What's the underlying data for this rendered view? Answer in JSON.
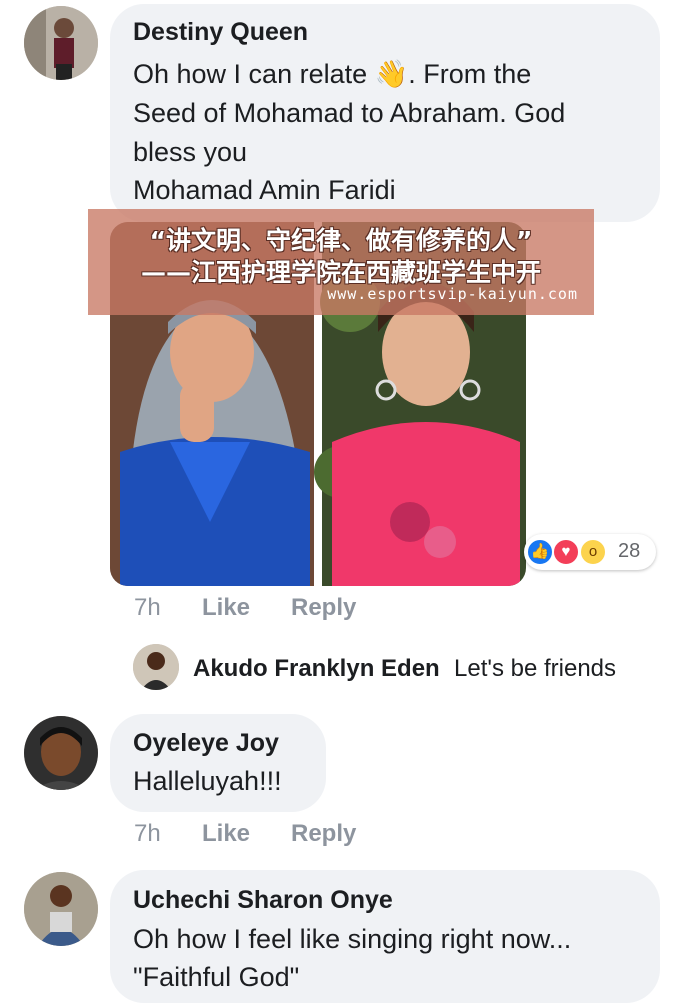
{
  "comments": [
    {
      "author": "Destiny Queen",
      "lines": [
        "Oh how I can relate 👋. From the",
        "Seed of Mohamad to Abraham. God",
        "bless you",
        "Mohamad Amin Faridi"
      ],
      "time": "7h",
      "like_label": "Like",
      "reply_label": "Reply",
      "reaction_count": "28",
      "reactions": [
        "like-icon",
        "love-icon",
        "wow-icon"
      ]
    },
    {
      "author": "Akudo Franklyn Eden",
      "text": "Let's be friends"
    },
    {
      "author": "Oyeleye Joy",
      "text": "Halleluyah!!!",
      "time": "7h",
      "like_label": "Like",
      "reply_label": "Reply"
    },
    {
      "author": "Uchechi Sharon Onye",
      "lines": [
        "Oh how I feel like singing right now...",
        "\"Faithful God\""
      ]
    }
  ],
  "watermark": {
    "line1": "“讲文明、守纪律、做有修养的人”",
    "line2": "——江西护理学院在西藏班学生中开",
    "url": "www.esportsvip-kaiyun.com"
  },
  "colors": {
    "bubble": "#f0f2f5",
    "meta": "#8d949e",
    "like": "#1877f2",
    "love": "#f33e58",
    "wow": "#fcd34d",
    "banner": "#c8786480"
  }
}
